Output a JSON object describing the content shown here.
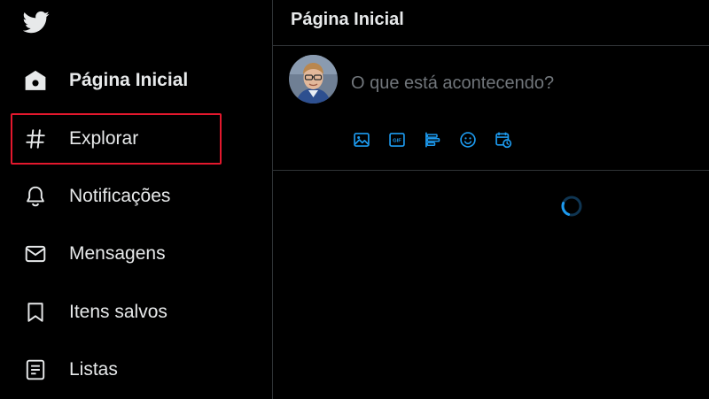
{
  "sidebar": {
    "logo_icon": "twitter-bird-icon",
    "items": [
      {
        "label": "Página Inicial",
        "icon": "home-icon",
        "active": true
      },
      {
        "label": "Explorar",
        "icon": "hashtag-icon",
        "highlighted": true
      },
      {
        "label": "Notificações",
        "icon": "bell-icon"
      },
      {
        "label": "Mensagens",
        "icon": "mail-icon"
      },
      {
        "label": "Itens salvos",
        "icon": "bookmark-icon"
      },
      {
        "label": "Listas",
        "icon": "list-icon"
      }
    ]
  },
  "main": {
    "title": "Página Inicial",
    "composer": {
      "placeholder": "O que está acontecendo?",
      "tools": [
        "image-icon",
        "gif-icon",
        "poll-icon",
        "emoji-icon",
        "schedule-icon"
      ],
      "gif_label": "GIF"
    }
  },
  "colors": {
    "accent": "#1d9bf0",
    "highlight_border": "#e3182d",
    "background": "#000000",
    "divider": "#2f3336",
    "text": "#e7e9ea",
    "placeholder": "#71767b"
  }
}
